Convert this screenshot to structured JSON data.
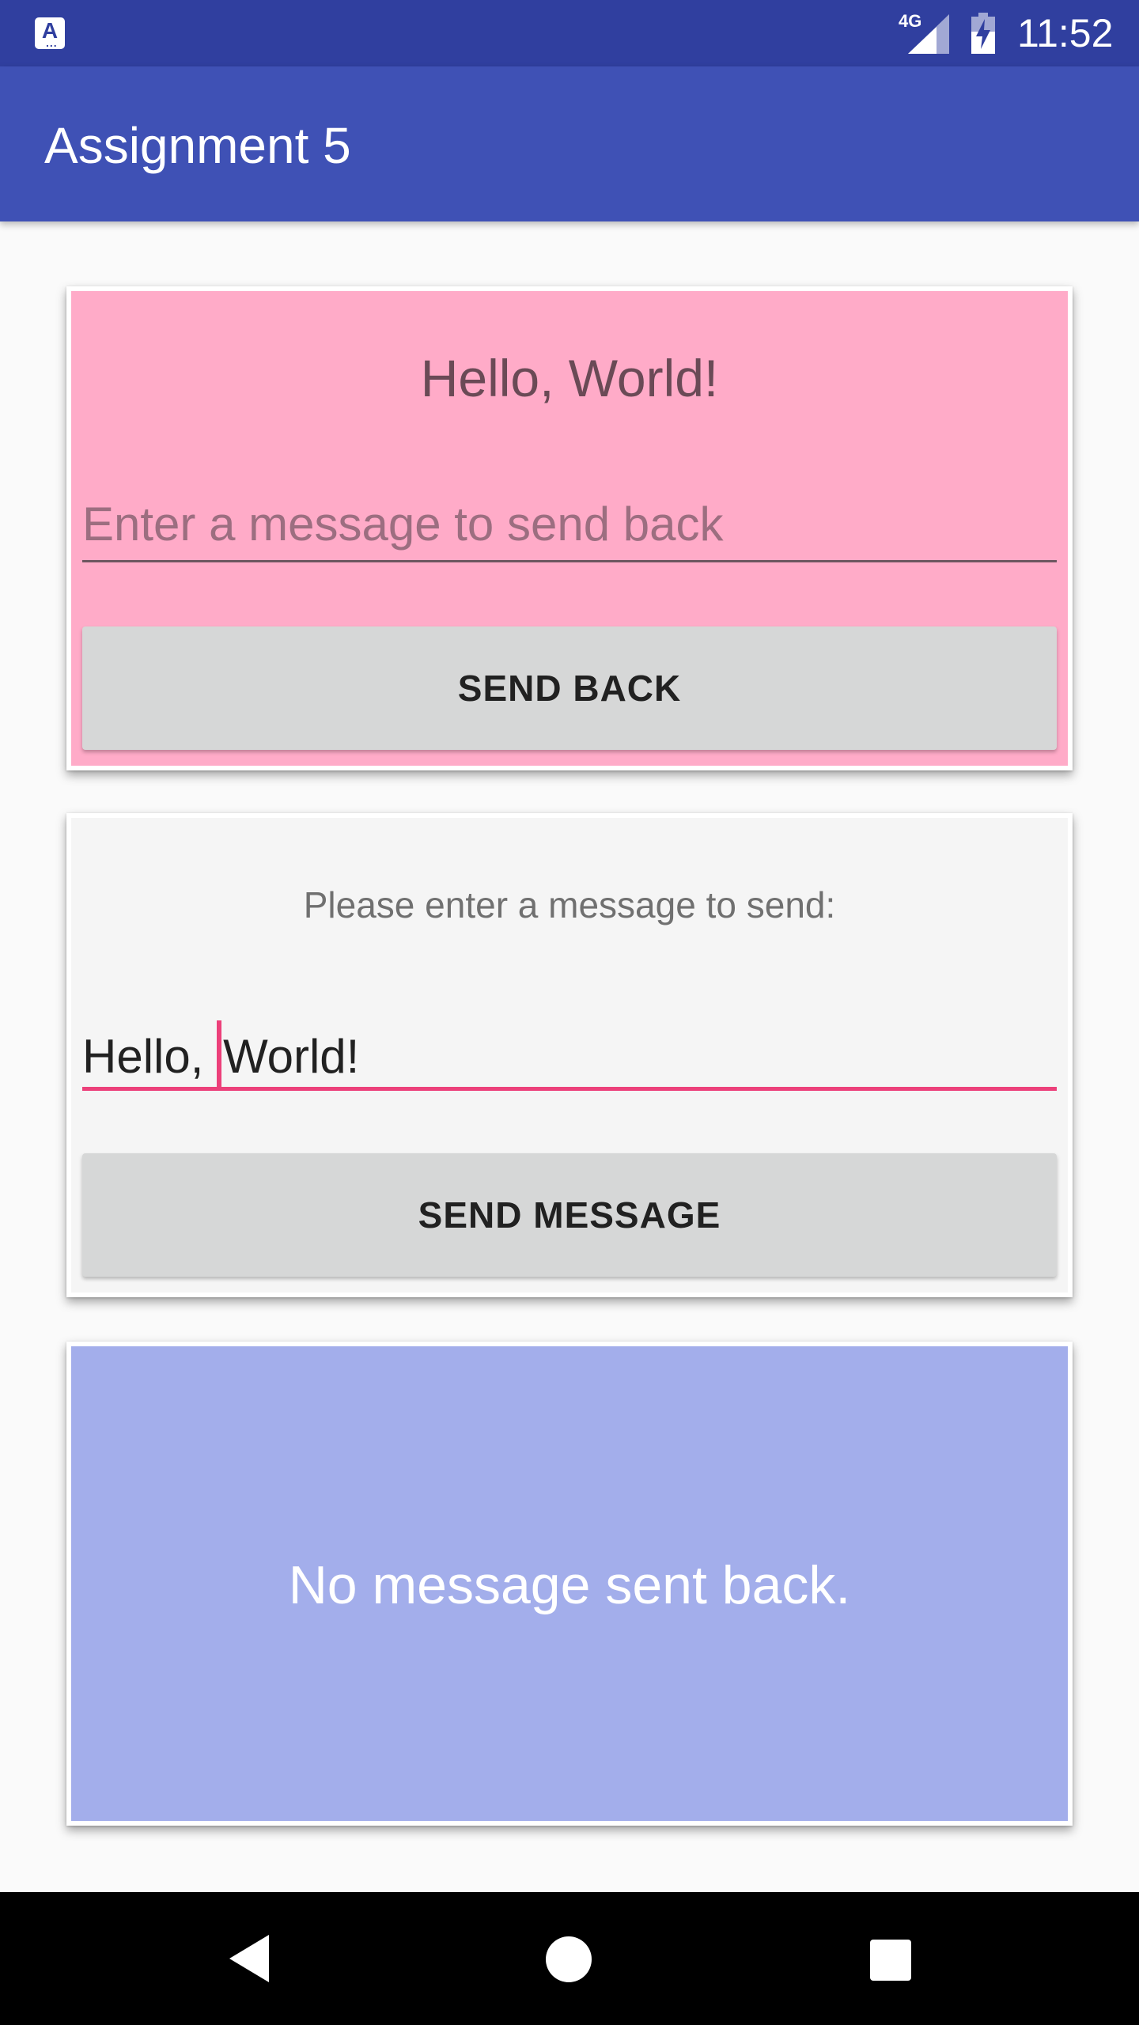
{
  "status_bar": {
    "network_label": "4G",
    "time": "11:52",
    "app_icon_letter": "A"
  },
  "app_bar": {
    "title": "Assignment 5"
  },
  "card_top": {
    "received_message": "Hello, World!",
    "reply_placeholder": "Enter a message to send back",
    "send_back_label": "SEND BACK",
    "background_color": "#ffabc8"
  },
  "card_middle": {
    "prompt": "Please enter a message to send:",
    "message_value_before_cursor": "Hello, ",
    "message_value_after_cursor": "World!",
    "send_message_label": "SEND MESSAGE",
    "accent_color": "#ec407a"
  },
  "card_bottom": {
    "reply_status": "No message sent back.",
    "background_color": "#a3aeeb"
  },
  "nav_bar": {
    "icons": [
      "back-icon",
      "home-icon",
      "recents-icon"
    ]
  }
}
